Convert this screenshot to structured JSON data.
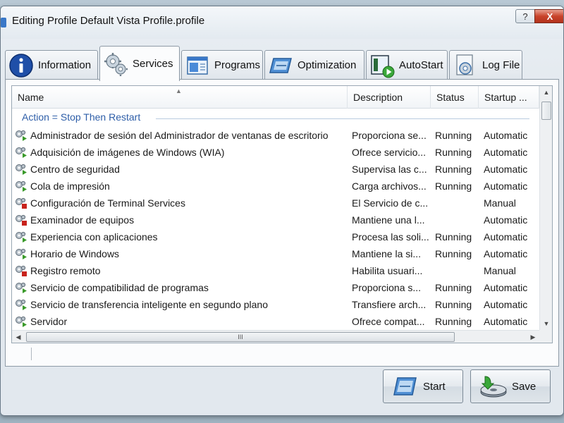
{
  "window": {
    "title": "Editing Profile Default Vista Profile.profile",
    "help_label": "?",
    "close_label": "X"
  },
  "tabs": [
    {
      "label": "Information",
      "icon": "info-icon",
      "active": false
    },
    {
      "label": "Services",
      "icon": "gears-icon",
      "active": true
    },
    {
      "label": "Programs",
      "icon": "programs-window-icon",
      "active": false
    },
    {
      "label": "Optimization",
      "icon": "optimization-icon",
      "active": false
    },
    {
      "label": "AutoStart",
      "icon": "autostart-play-icon",
      "active": false
    },
    {
      "label": "Log File",
      "icon": "log-file-gear-icon",
      "active": false
    }
  ],
  "list": {
    "columns": {
      "name": "Name",
      "description": "Description",
      "status": "Status",
      "startup": "Startup ..."
    },
    "sort_arrow": "▲",
    "group_label": "Action = Stop Then Restart",
    "rows": [
      {
        "name": "Administrador de sesión del Administrador de ventanas de escritorio",
        "description": "Proporciona se...",
        "status": "Running",
        "startup": "Automatic",
        "icon": "service-running-icon"
      },
      {
        "name": "Adquisición de imágenes de Windows (WIA)",
        "description": "Ofrece servicio...",
        "status": "Running",
        "startup": "Automatic",
        "icon": "service-running-icon"
      },
      {
        "name": "Centro de seguridad",
        "description": "Supervisa las c...",
        "status": "Running",
        "startup": "Automatic",
        "icon": "service-running-icon"
      },
      {
        "name": "Cola de impresión",
        "description": "Carga archivos...",
        "status": "Running",
        "startup": "Automatic",
        "icon": "service-running-icon"
      },
      {
        "name": "Configuración de Terminal Services",
        "description": "El Servicio de c...",
        "status": "",
        "startup": "Manual",
        "icon": "service-stopped-icon"
      },
      {
        "name": "Examinador de equipos",
        "description": "Mantiene una l...",
        "status": "",
        "startup": "Automatic",
        "icon": "service-stopped-icon"
      },
      {
        "name": "Experiencia con aplicaciones",
        "description": "Procesa las soli...",
        "status": "Running",
        "startup": "Automatic",
        "icon": "service-running-icon"
      },
      {
        "name": "Horario de Windows",
        "description": "Mantiene la si...",
        "status": "Running",
        "startup": "Automatic",
        "icon": "service-running-icon"
      },
      {
        "name": "Registro remoto",
        "description": "Habilita usuari...",
        "status": "",
        "startup": "Manual",
        "icon": "service-stopped-icon"
      },
      {
        "name": "Servicio de compatibilidad de programas",
        "description": "Proporciona s...",
        "status": "Running",
        "startup": "Automatic",
        "icon": "service-running-icon"
      },
      {
        "name": "Servicio de transferencia inteligente en segundo plano",
        "description": "Transfiere arch...",
        "status": "Running",
        "startup": "Automatic",
        "icon": "service-running-icon"
      },
      {
        "name": "Servidor",
        "description": "Ofrece compat...",
        "status": "Running",
        "startup": "Automatic",
        "icon": "service-running-icon"
      }
    ]
  },
  "scroll": {
    "h_thumb_grip": "III"
  },
  "buttons": {
    "start_label": "Start",
    "save_label": "Save"
  },
  "colors": {
    "running": "#3a9a2a",
    "stopped": "#c8231c",
    "group": "#2e5ea8"
  }
}
